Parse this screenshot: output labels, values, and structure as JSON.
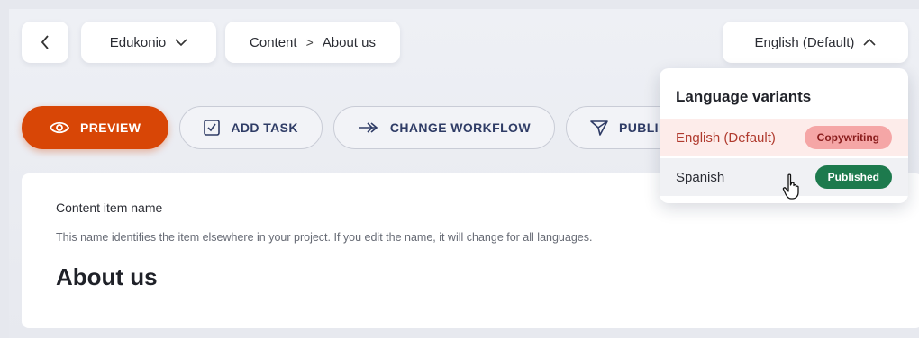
{
  "topbar": {
    "project_label": "Edukonio",
    "breadcrumb_section": "Content",
    "breadcrumb_separator": ">",
    "breadcrumb_item": "About us",
    "language_label": "English (Default)"
  },
  "toolbar": {
    "preview_label": "PREVIEW",
    "add_task_label": "ADD TASK",
    "change_workflow_label": "CHANGE WORKFLOW",
    "publish_label": "PUBLI"
  },
  "content": {
    "field_label": "Content item name",
    "field_help": "This name identifies the item elsewhere in your project. If you edit the name, it will change for all languages.",
    "field_value": "About us"
  },
  "language_dropdown": {
    "title": "Language variants",
    "variants": [
      {
        "name": "English (Default)",
        "status": "Copywriting"
      },
      {
        "name": "Spanish",
        "status": "Published"
      }
    ]
  },
  "colors": {
    "primary": "#d84606",
    "copywriting_badge": "#f5a6a6",
    "published_badge": "#1d7a4d"
  }
}
